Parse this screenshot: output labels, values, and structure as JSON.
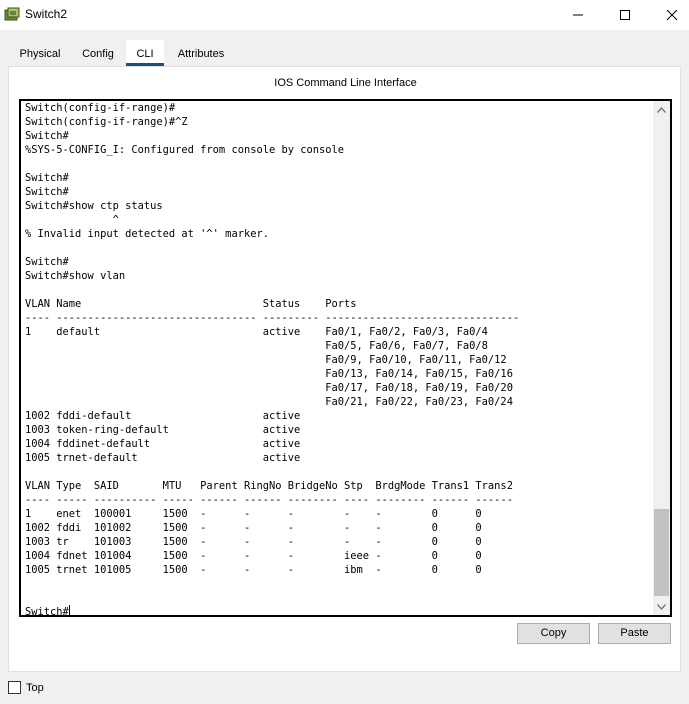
{
  "window": {
    "title": "Switch2"
  },
  "tabs": [
    {
      "label": "Physical"
    },
    {
      "label": "Config"
    },
    {
      "label": "CLI"
    },
    {
      "label": "Attributes"
    }
  ],
  "cli": {
    "heading": "IOS Command Line Interface",
    "output_lines": [
      "Switch(config-if-range)#",
      "Switch(config-if-range)#^Z",
      "Switch#",
      "%SYS-5-CONFIG_I: Configured from console by console",
      "",
      "Switch#",
      "Switch#",
      "Switch#show ctp status",
      "              ^",
      "% Invalid input detected at '^' marker.",
      "",
      "Switch#",
      "Switch#show vlan",
      "",
      "VLAN Name                             Status    Ports",
      "---- -------------------------------- --------- -------------------------------",
      "1    default                          active    Fa0/1, Fa0/2, Fa0/3, Fa0/4",
      "                                                Fa0/5, Fa0/6, Fa0/7, Fa0/8",
      "                                                Fa0/9, Fa0/10, Fa0/11, Fa0/12",
      "                                                Fa0/13, Fa0/14, Fa0/15, Fa0/16",
      "                                                Fa0/17, Fa0/18, Fa0/19, Fa0/20",
      "                                                Fa0/21, Fa0/22, Fa0/23, Fa0/24",
      "1002 fddi-default                     active",
      "1003 token-ring-default               active",
      "1004 fddinet-default                  active",
      "1005 trnet-default                    active",
      "",
      "VLAN Type  SAID       MTU   Parent RingNo BridgeNo Stp  BrdgMode Trans1 Trans2",
      "---- ----- ---------- ----- ------ ------ -------- ---- -------- ------ ------",
      "1    enet  100001     1500  -      -      -        -    -        0      0",
      "1002 fddi  101002     1500  -      -      -        -    -        0      0",
      "1003 tr    101003     1500  -      -      -        -    -        0      0",
      "1004 fdnet 101004     1500  -      -      -        ieee -        0      0",
      "1005 trnet 101005     1500  -      -      -        ibm  -        0      0",
      "",
      "",
      "Switch#"
    ]
  },
  "buttons": {
    "copy": "Copy",
    "paste": "Paste"
  },
  "footer": {
    "top_label": "Top"
  }
}
